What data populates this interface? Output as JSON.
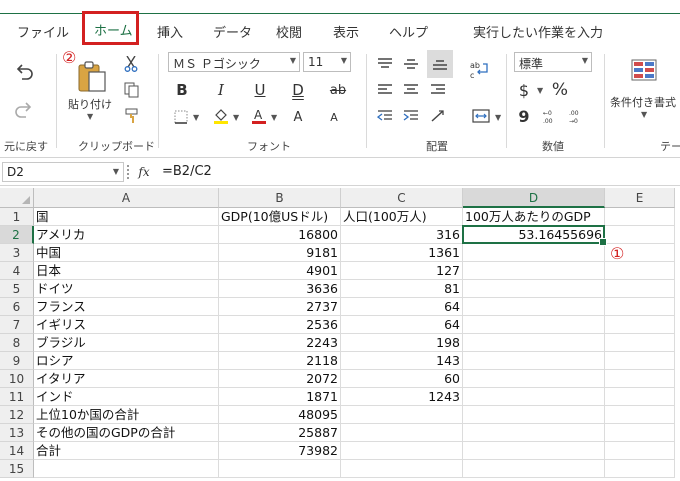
{
  "tabs": {
    "file": "ファイル",
    "home": "ホーム",
    "insert": "挿入",
    "data": "データ",
    "review": "校閲",
    "view": "表示",
    "help": "ヘルプ",
    "tellme": "実行したい作業を入力"
  },
  "markers": {
    "m1": "①",
    "m2": "②"
  },
  "ribbon": {
    "undo_label": "元に戻す",
    "paste_label": "貼り付け",
    "clipboard_label": "クリップボード",
    "font_label": "フォント",
    "alignment_label": "配置",
    "number_label": "数値",
    "styles_label": "テー",
    "font_name": "ＭＳ Ｐゴシック",
    "font_size": "11",
    "number_format": "標準",
    "conditional_label": "条件付き書式",
    "bold": "B",
    "italic": "I",
    "underline": "U",
    "double_underline": "D",
    "strike": "ab",
    "font_grow": "A",
    "font_shrink": "A",
    "currency": "$",
    "percent": "%",
    "comma": "9"
  },
  "formula_bar": {
    "name_box": "D2",
    "fx": "fx",
    "formula": "=B2/C2"
  },
  "accent": "#1e7145",
  "marker_color": "#d32020",
  "sheet": {
    "columns": [
      "A",
      "B",
      "C",
      "D",
      "E"
    ],
    "rows": [
      [
        "1",
        "国",
        "GDP(10億USドル)",
        "人口(100万人)",
        "100万人あたりのGDP"
      ],
      [
        "2",
        "アメリカ",
        "16800",
        "316",
        "53.16455696"
      ],
      [
        "3",
        "中国",
        "9181",
        "1361",
        ""
      ],
      [
        "4",
        "日本",
        "4901",
        "127",
        ""
      ],
      [
        "5",
        "ドイツ",
        "3636",
        "81",
        ""
      ],
      [
        "6",
        "フランス",
        "2737",
        "64",
        ""
      ],
      [
        "7",
        "イギリス",
        "2536",
        "64",
        ""
      ],
      [
        "8",
        "ブラジル",
        "2243",
        "198",
        ""
      ],
      [
        "9",
        "ロシア",
        "2118",
        "143",
        ""
      ],
      [
        "10",
        "イタリア",
        "2072",
        "60",
        ""
      ],
      [
        "11",
        "インド",
        "1871",
        "1243",
        ""
      ],
      [
        "12",
        "上位10か国の合計",
        "48095",
        "",
        ""
      ],
      [
        "13",
        "その他の国のGDPの合計",
        "25887",
        "",
        ""
      ],
      [
        "14",
        "合計",
        "73982",
        "",
        ""
      ],
      [
        "15",
        "",
        "",
        "",
        ""
      ]
    ]
  }
}
